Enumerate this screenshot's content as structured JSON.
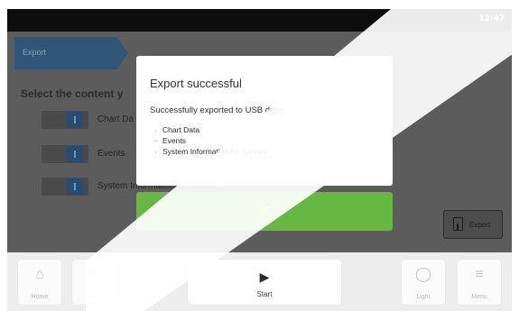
{
  "status_bar": {
    "time": "12:47"
  },
  "header": {
    "tab_label": "Export"
  },
  "content": {
    "title": "Select the content y",
    "options": [
      {
        "label": "Chart Da"
      },
      {
        "label": "Events"
      },
      {
        "label": "System Information for Service"
      }
    ],
    "export_button_label": "Export"
  },
  "dialog": {
    "title": "Export successful",
    "message": "Successfully exported to USB drive",
    "items": [
      "Chart Data",
      "Events",
      "System Information for Service"
    ],
    "confirm_icon": "checkmark-icon"
  },
  "nav": {
    "home_label": "Home",
    "back_label": "Back",
    "start_label": "Start",
    "light_label": "Light",
    "menu_label": "Menu"
  },
  "colors": {
    "accent_blue": "#2f5677",
    "confirm_green": "#66b744"
  }
}
